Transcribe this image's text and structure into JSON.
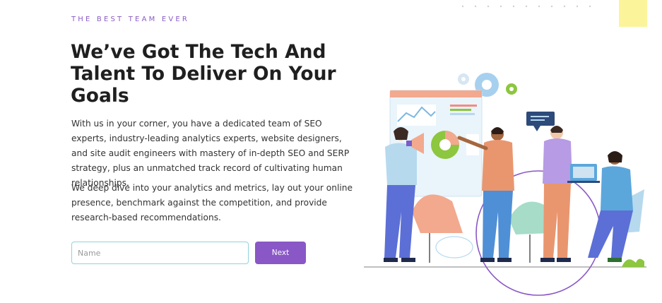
{
  "hero": {
    "eyebrow": "THE BEST TEAM EVER",
    "title": "We’ve Got The Tech And Talent To Deliver On Your Goals",
    "paragraph1": "With us in your corner, you have a dedicated team of SEO experts, industry-leading analytics experts, website designers, and site audit engineers with mastery of in-depth SEO and SERP strategy, plus an unmatched track record of cultivating human relationships.",
    "paragraph2": "We deep dive into your analytics and metrics, lay out your online presence, benchmark against the competition, and provide research-based recommendations."
  },
  "form": {
    "name_value": "",
    "name_placeholder": "Name",
    "next_label": "Next"
  },
  "colors": {
    "accent_purple": "#8a57c6",
    "input_border": "#8fd3de",
    "decor_yellow": "#fbf49b"
  },
  "illustration": {
    "icons": [
      "gear-icon",
      "bar-chart-icon",
      "pie-chart-icon",
      "megaphone-icon",
      "laptop-icon",
      "chat-bubble-icon"
    ]
  }
}
